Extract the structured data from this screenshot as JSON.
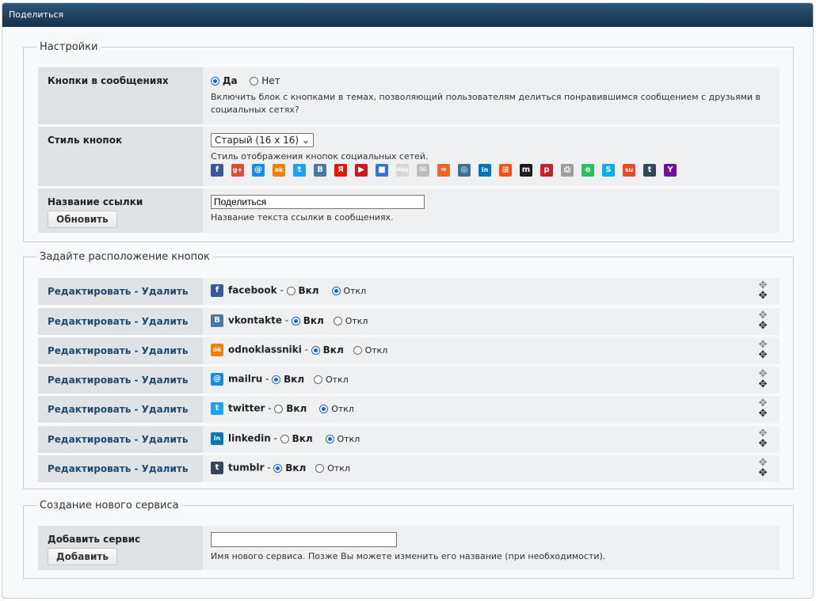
{
  "window": {
    "title": "Поделиться"
  },
  "settings": {
    "legend": "Настройки",
    "buttons_in_posts": {
      "label": "Кнопки в сообщениях",
      "yes": "Да",
      "no": "Нет",
      "selected": "yes",
      "hint": "Включить блок с кнопками в темах, позволяющий пользователям делиться понравившимся сообщением с друзьями в социальных сетях?"
    },
    "button_style": {
      "label": "Стиль кнопок",
      "selected": "Старый (16 x 16)",
      "hint": "Стиль отображения кнопок социальных сетей.",
      "icons": [
        {
          "name": "facebook-icon",
          "glyph": "f",
          "color": "#3b5998"
        },
        {
          "name": "googleplus-icon",
          "glyph": "g+",
          "color": "#dd4b39"
        },
        {
          "name": "mailru-icon",
          "glyph": "@",
          "color": "#168de2"
        },
        {
          "name": "odnoklassniki-icon",
          "glyph": "ok",
          "color": "#ee8208"
        },
        {
          "name": "twitter-icon",
          "glyph": "t",
          "color": "#1da1f2"
        },
        {
          "name": "vkontakte-icon",
          "glyph": "B",
          "color": "#4a76a8"
        },
        {
          "name": "yandex-icon",
          "glyph": "Я",
          "color": "#e61400"
        },
        {
          "name": "youtube-icon",
          "glyph": "▶",
          "color": "#cc181e"
        },
        {
          "name": "delicious-icon",
          "glyph": "■",
          "color": "#3274d1"
        },
        {
          "name": "digg-icon",
          "glyph": "digg",
          "color": "#d6d6d6"
        },
        {
          "name": "email-icon",
          "glyph": "✉",
          "color": "#bdbdbd"
        },
        {
          "name": "rss-icon",
          "glyph": "≈",
          "color": "#f26522"
        },
        {
          "name": "instagram-icon",
          "glyph": "◎",
          "color": "#3f729b"
        },
        {
          "name": "linkedin-icon",
          "glyph": "in",
          "color": "#0077b5"
        },
        {
          "name": "windows-live-icon",
          "glyph": "⊞",
          "color": "#f65314"
        },
        {
          "name": "myspace-icon",
          "glyph": "m",
          "color": "#1c1c1c"
        },
        {
          "name": "pinterest-icon",
          "glyph": "p",
          "color": "#cb2027"
        },
        {
          "name": "print-icon",
          "glyph": "⎙",
          "color": "#9e9e9e"
        },
        {
          "name": "evernote-icon",
          "glyph": "e",
          "color": "#2dbe60"
        },
        {
          "name": "skype-icon",
          "glyph": "S",
          "color": "#00aff0"
        },
        {
          "name": "stumbleupon-icon",
          "glyph": "su",
          "color": "#eb4924"
        },
        {
          "name": "tumblr-icon",
          "glyph": "t",
          "color": "#35465c"
        },
        {
          "name": "yahoo-icon",
          "glyph": "Y",
          "color": "#720e9e"
        }
      ]
    },
    "link_name": {
      "label": "Название ссылки",
      "button": "Обновить",
      "value": "Поделиться",
      "hint": "Название текста ссылки в сообщениях."
    }
  },
  "placement": {
    "legend": "Задайте расположение кнопок",
    "action_label": "Редактировать - Удалить",
    "on_label": "Вкл",
    "off_label": "Откл",
    "services": [
      {
        "name": "facebook",
        "state": "off",
        "icon": "facebook-icon",
        "glyph": "f",
        "color": "#3b5998"
      },
      {
        "name": "vkontakte",
        "state": "on",
        "icon": "vkontakte-icon",
        "glyph": "B",
        "color": "#4a76a8"
      },
      {
        "name": "odnoklassniki",
        "state": "on",
        "icon": "odnoklassniki-icon",
        "glyph": "ok",
        "color": "#ee8208"
      },
      {
        "name": "mailru",
        "state": "on",
        "icon": "mailru-icon",
        "glyph": "@",
        "color": "#168de2"
      },
      {
        "name": "twitter",
        "state": "off",
        "icon": "twitter-icon",
        "glyph": "t",
        "color": "#1da1f2"
      },
      {
        "name": "linkedin",
        "state": "off",
        "icon": "linkedin-icon",
        "glyph": "in",
        "color": "#0077b5"
      },
      {
        "name": "tumblr",
        "state": "on",
        "icon": "tumblr-icon",
        "glyph": "t",
        "color": "#35465c"
      }
    ]
  },
  "new_service": {
    "legend": "Создание нового сервиса",
    "label": "Добавить сервис",
    "button": "Добавить",
    "value": "",
    "hint": "Имя нового сервиса. Позже Вы можете изменить его название (при необходимости)."
  }
}
